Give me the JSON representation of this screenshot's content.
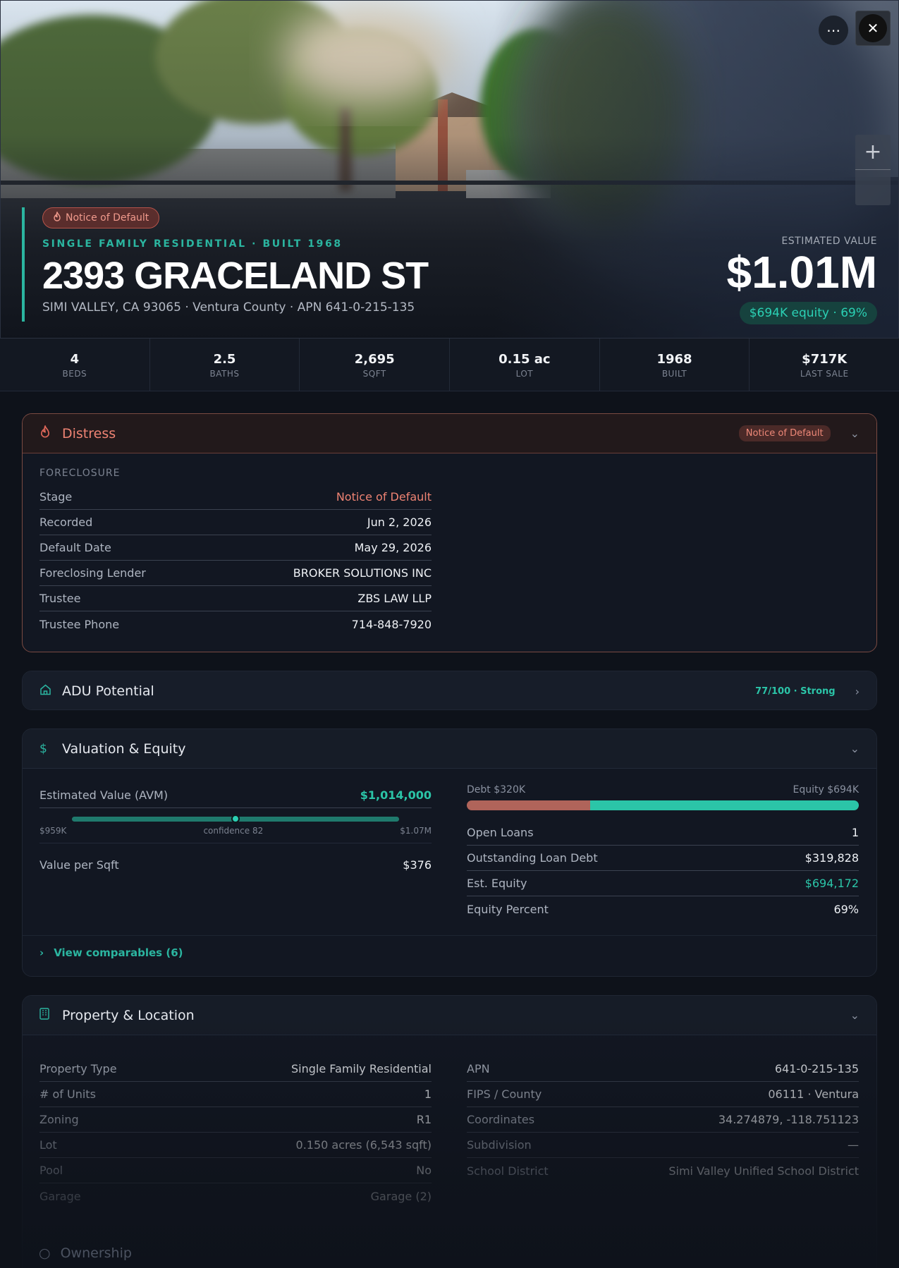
{
  "hero": {
    "distress_pill": "Notice of Default",
    "eyebrow": "SINGLE FAMILY RESIDENTIAL · BUILT 1968",
    "address": "2393 GRACELAND ST",
    "subaddress": "SIMI VALLEY, CA 93065 · Ventura County · APN 641-0-215-135",
    "est_label": "ESTIMATED VALUE",
    "est_value": "$1.01M",
    "equity_pill": "$694K equity · 69%"
  },
  "stats": [
    {
      "value": "4",
      "label": "BEDS"
    },
    {
      "value": "2.5",
      "label": "BATHS"
    },
    {
      "value": "2,695",
      "label": "SQFT"
    },
    {
      "value": "0.15 ac",
      "label": "LOT"
    },
    {
      "value": "1968",
      "label": "BUILT"
    },
    {
      "value": "$717K",
      "label": "LAST SALE"
    }
  ],
  "distress": {
    "title": "Distress",
    "badge": "Notice of Default",
    "section": "FORECLOSURE",
    "rows": [
      {
        "k": "Stage",
        "v": "Notice of Default"
      },
      {
        "k": "Recorded",
        "v": "Jun 2, 2026"
      },
      {
        "k": "Default Date",
        "v": "May 29, 2026"
      },
      {
        "k": "Foreclosing Lender",
        "v": "BROKER SOLUTIONS INC"
      },
      {
        "k": "Trustee",
        "v": "ZBS LAW LLP"
      },
      {
        "k": "Trustee Phone",
        "v": "714-848-7920"
      }
    ]
  },
  "adu": {
    "title": "ADU Potential",
    "score": "77/100 · Strong"
  },
  "valuation": {
    "title": "Valuation & Equity",
    "avm_label": "Estimated Value (AVM)",
    "avm_value": "$1,014,000",
    "range_low": "$959K",
    "confidence": "confidence 82",
    "range_high": "$1.07M",
    "avm_position": 0.5,
    "per_sqft_label": "Value per Sqft",
    "per_sqft_value": "$376",
    "debt_label": "Debt $320K",
    "equity_label": "Equity $694K",
    "debt_fraction": 0.315,
    "rows": [
      {
        "k": "Open Loans",
        "v": "1"
      },
      {
        "k": "Outstanding Loan Debt",
        "v": "$319,828"
      },
      {
        "k": "Est. Equity",
        "v": "$694,172"
      },
      {
        "k": "Equity Percent",
        "v": "69%"
      }
    ],
    "comps": "View comparables (6)"
  },
  "property": {
    "title": "Property & Location",
    "left": [
      {
        "k": "Property Type",
        "v": "Single Family Residential"
      },
      {
        "k": "# of Units",
        "v": "1"
      },
      {
        "k": "Zoning",
        "v": "R1"
      },
      {
        "k": "Lot",
        "v": "0.150 acres (6,543 sqft)"
      },
      {
        "k": "Pool",
        "v": "No"
      },
      {
        "k": "Garage",
        "v": "Garage (2)"
      }
    ],
    "right": [
      {
        "k": "APN",
        "v": "641-0-215-135"
      },
      {
        "k": "FIPS / County",
        "v": "06111 · Ventura"
      },
      {
        "k": "Coordinates",
        "v": "34.274879, -118.751123"
      },
      {
        "k": "Subdivision",
        "v": "—"
      },
      {
        "k": "School District",
        "v": "Simi Valley Unified School District"
      }
    ]
  },
  "ownership": {
    "title": "Ownership"
  },
  "colors": {
    "accent": "#2bb5a0",
    "danger": "#ee8373",
    "debt": "#b0645a",
    "equity": "#2bc5a8"
  }
}
